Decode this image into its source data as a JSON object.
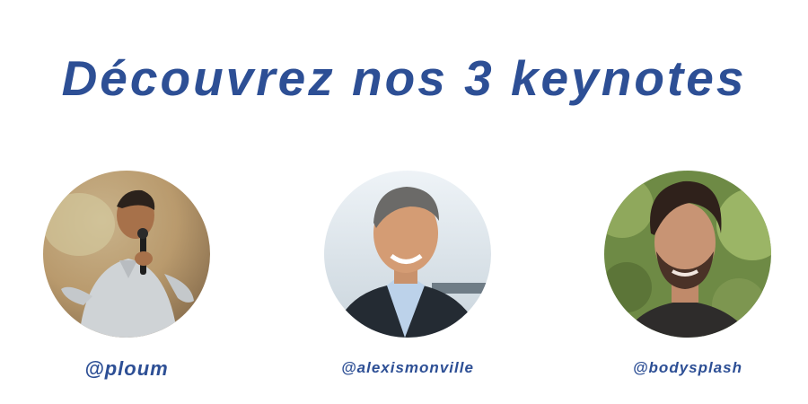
{
  "heading": "Découvrez nos 3 keynotes",
  "accent_color": "#2d4f95",
  "speakers": [
    {
      "handle": "@ploum",
      "photo": "speaker-photo-presenting-with-microphone"
    },
    {
      "handle": "@alexismonville",
      "photo": "speaker-photo-smiling-outdoors"
    },
    {
      "handle": "@bodysplash",
      "photo": "speaker-photo-bearded-greenery"
    }
  ]
}
